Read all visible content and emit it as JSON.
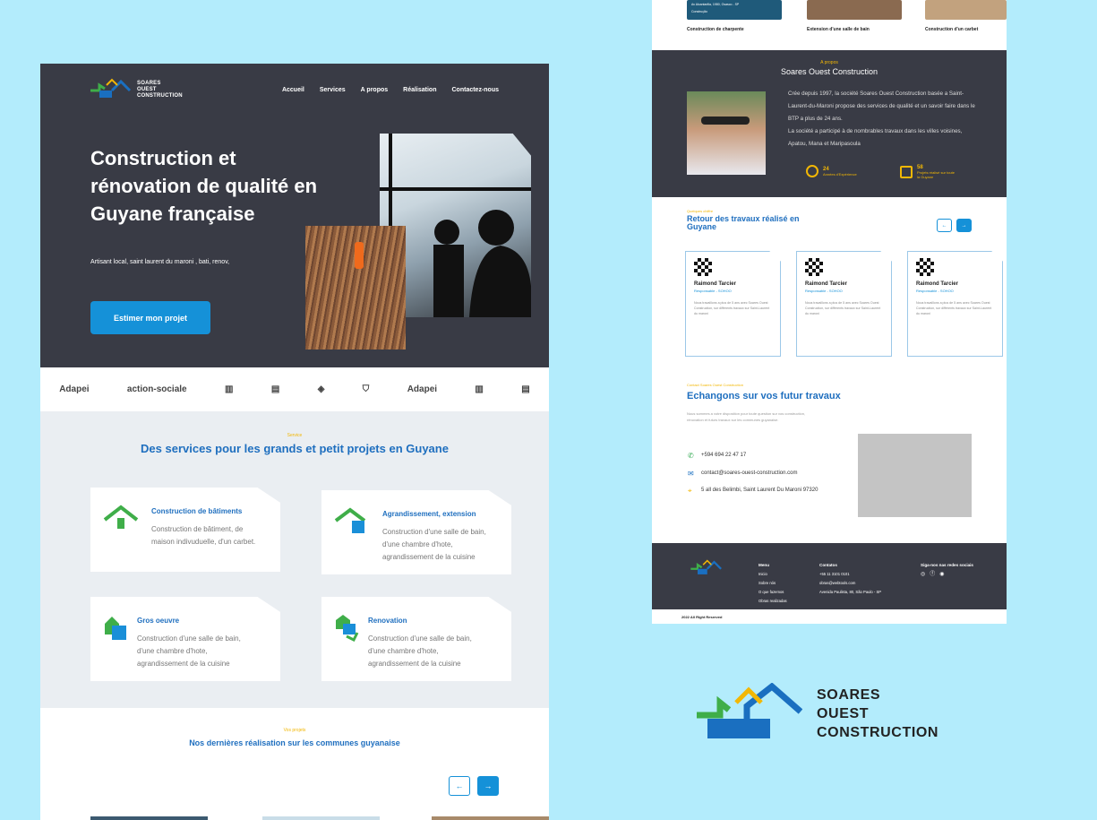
{
  "brand": {
    "line1": "SOARES",
    "line2": "OUEST",
    "line3": "CONSTRUCTION",
    "colors": {
      "green": "#3fae49",
      "blue": "#1a6fc0",
      "yellow": "#f2b705",
      "dark": "#393b45",
      "bg": "#b3ecfc"
    }
  },
  "nav": {
    "items": [
      "Accueil",
      "Services",
      "A propos",
      "Réalisation",
      "Contactez-nous"
    ]
  },
  "hero": {
    "title": "Construction et rénovation de qualité en Guyane française",
    "subtitle": "Artisant local, saint laurent du maroni , bati, renov,",
    "cta": "Estimer mon projet"
  },
  "partners": [
    "Adapei",
    "action-sociale",
    "logo-3",
    "logo-4",
    "logo-5",
    "logo-6",
    "Adapei",
    "logo-8",
    "logo-9"
  ],
  "services": {
    "tag": "Service",
    "title": "Des services pour les grands et petit projets en Guyane",
    "cards": [
      {
        "title": "Construction de bâtiments",
        "desc": "Construction de bâtiment, de maison indivuduelle, d'un carbet."
      },
      {
        "title": "Agrandissement, extension",
        "desc": "Construction d'une salle de bain, d'une chambre d'hote, agrandissement de la cuisine"
      },
      {
        "title": "Gros oeuvre",
        "desc": "Construction d'une salle de bain, d'une chambre d'hote, agrandissement de la cuisine"
      },
      {
        "title": "Renovation",
        "desc": "Construction d'une salle de bain, d'une chambre d'hote, agrandissement de la cuisine"
      }
    ]
  },
  "projects": {
    "tag": "Vos projets",
    "title": "Nos dernières réalisation sur les communes guyanaise",
    "prev": "←",
    "next": "→"
  },
  "right": {
    "top_caps": [
      "Construction de charpente",
      "Extension d'une salle de bain",
      "Construction d'un carbet"
    ],
    "top_info": {
      "address": "Av Alcantarilla, 1980, Osasco - SP",
      "tag": "Construção"
    },
    "about": {
      "tag": "A propos",
      "title": "Soares Ouest Construction",
      "p1": "Crée depuis 1997, la société Soares Ouest Construction basée a Saint-Laurent-du-Maroni propose des services de qualité et un savoir faire dans le BTP a plus de 24 ans.",
      "p2": "La société a participé à de nombrables travaux dans les villes voisines, Apatou, Mana et Maripasoula",
      "stats": [
        {
          "n": "24",
          "label": "Années d'Expérience"
        },
        {
          "n": "58",
          "label": "Projets réalisé sur toute la Guyane"
        }
      ]
    },
    "works": {
      "tag": "Quelques chiffre",
      "title": "Retour des travaux réalisé en Guyane",
      "prev": "←",
      "next": "→",
      "cards": [
        {
          "name": "Raimond Tarcier",
          "role": "Responsable - SOHOO",
          "text": "Nous travaillons a plus de 5 ans avec Soares Ouest Construction, sur différents travaux sur Saint-Laurent du maroni"
        },
        {
          "name": "Raimond Tarcier",
          "role": "Responsable - SOHOO",
          "text": "Nous travaillons a plus de 5 ans avec Soares Ouest Construction, sur différents travaux sur Saint-Laurent du maroni"
        },
        {
          "name": "Raimond Tarcier",
          "role": "Responsable - SOHOO",
          "text": "Nous travaillons a plus de 5 ans avec Soares Ouest Construction, sur différents travaux sur Saint-Laurent du maroni"
        }
      ]
    },
    "contact": {
      "tag": "Contact Soares Ouest Construction",
      "title": "Echangons sur vos futur travaux",
      "desc": "Nous sommes a votre disposition pour toute question sur vos construction, rénovation et futurs travaux sur les communes guyanaise.",
      "phone": "+594 694 22 47 17",
      "email": "contact@soares-ouest-construction.com",
      "address": "5 all des Belimbi, Saint Laurent Du Maroni 97320"
    },
    "footer": {
      "menu_title": "Menu",
      "menu": [
        "Inicio",
        "Sobre nós",
        "O que fazemos",
        "Obras realizadas"
      ],
      "contacts_title": "Contatos",
      "contacts": [
        "+55 11 3101 0101",
        "obras@webtools.com",
        "Avenida Paulista, 80, São Paulo - SP"
      ],
      "social_title": "Siga-nos nas redes sociais",
      "copyright": "2022 All Right Reserved"
    }
  }
}
